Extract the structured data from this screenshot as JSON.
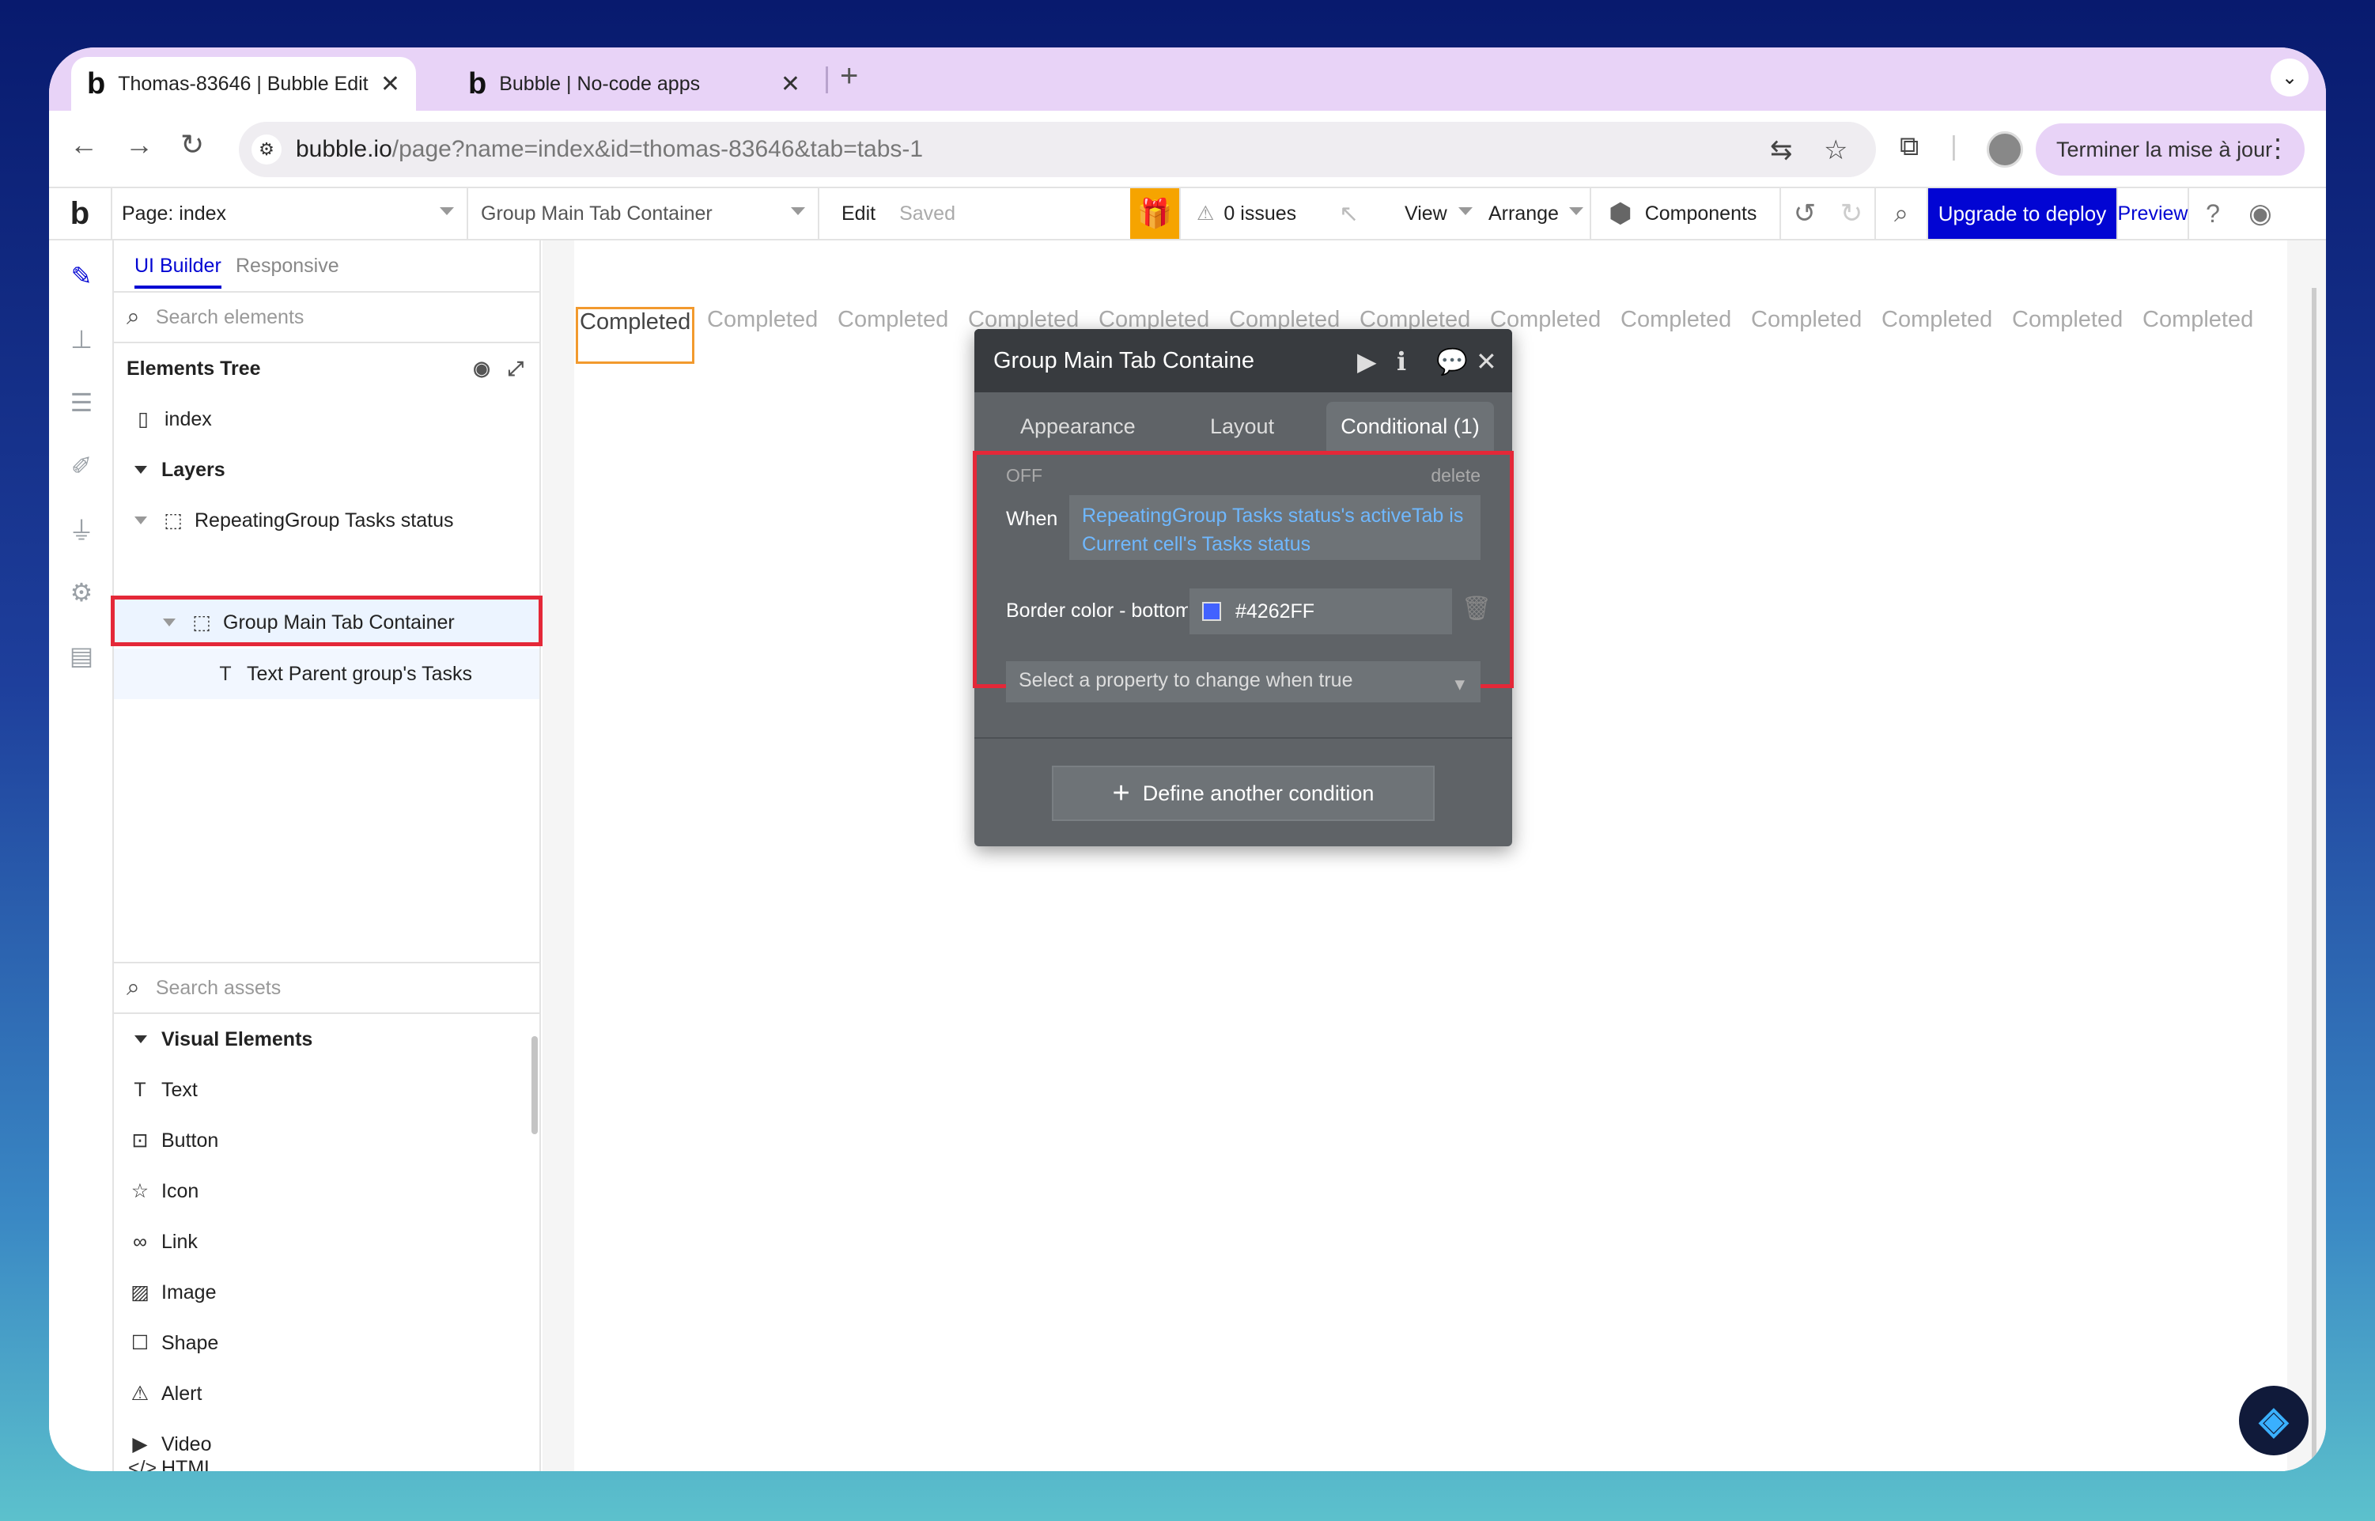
{
  "browser": {
    "tabs": [
      {
        "title": "Thomas-83646 | Bubble Edit",
        "favicon": "b"
      },
      {
        "title": "Bubble | No-code apps",
        "favicon": "b"
      }
    ],
    "new_tab": "+",
    "url_host": "bubble.io",
    "url_path": "/page?name=index&id=thomas-83646&tab=tabs-1",
    "update_button": "Terminer la mise à jour"
  },
  "editor": {
    "logo": "b",
    "page_select": "Page: index",
    "element_select": "Group Main Tab Container",
    "edit": "Edit",
    "saved": "Saved",
    "issues": "0 issues",
    "view": "View",
    "arrange": "Arrange",
    "components": "Components",
    "upgrade": "Upgrade to deploy",
    "preview": "Preview",
    "colors": {
      "upgrade": "#0205d3",
      "gift": "#f6a400",
      "highlight": "#e42838"
    }
  },
  "panel": {
    "tabs": [
      "UI Builder",
      "Responsive"
    ],
    "search_placeholder": "Search elements",
    "tree_title": "Elements Tree",
    "tree": {
      "index": "index",
      "layers": "Layers",
      "repeating_group": "RepeatingGroup Tasks status",
      "group_main": "Group Main Tab Container",
      "text_parent": "Text Parent group's Tasks"
    },
    "assets_placeholder": "Search assets",
    "visual_elements": "Visual Elements",
    "elements": [
      "Text",
      "Button",
      "Icon",
      "Link",
      "Image",
      "Shape",
      "Alert",
      "Video",
      "HTML"
    ]
  },
  "canvas": {
    "cells": [
      "Completed",
      "Completed",
      "Completed",
      "Completed",
      "Completed",
      "Completed",
      "Completed",
      "Completed",
      "Completed",
      "Completed",
      "Completed",
      "Completed",
      "Completed"
    ]
  },
  "dialog": {
    "title": "Group Main Tab Containe",
    "tabs": [
      "Appearance",
      "Layout",
      "Conditional (1)"
    ],
    "off": "OFF",
    "delete": "delete",
    "when": "When",
    "expression": "RepeatingGroup Tasks status's activeTab is Current cell's Tasks status",
    "property": "Border color - bottom",
    "color_value": "#4262FF",
    "select_placeholder": "Select a property to change when true",
    "define": "Define another condition"
  }
}
